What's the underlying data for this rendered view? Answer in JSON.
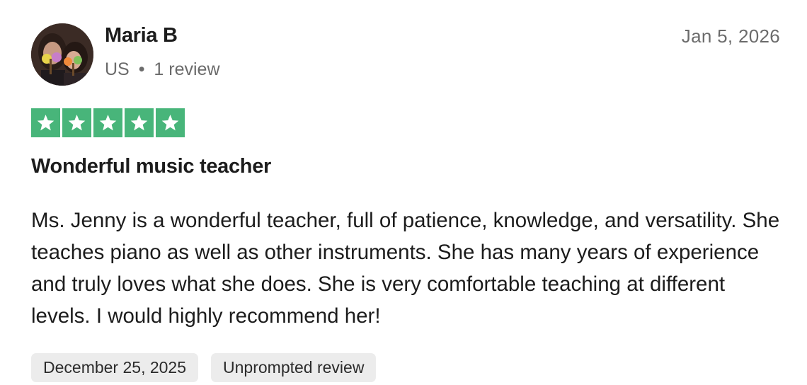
{
  "review": {
    "reviewer_name": "Maria B",
    "country": "US",
    "separator": "•",
    "review_count": "1 review",
    "date": "Jan 5, 2026",
    "rating": 5,
    "rating_max": 5,
    "title": "Wonderful music teacher",
    "body": "Ms. Jenny is a wonderful teacher, full of patience, knowledge, and versatility. She teaches piano as well as other instruments. She has many years of experience and truly loves what she does. She is very comfortable teaching at different levels. I would highly recommend her!",
    "tags": {
      "experience_date": "December 25, 2025",
      "review_type": "Unprompted review"
    }
  },
  "colors": {
    "star_green": "#48b57a",
    "tag_background": "#ececec",
    "muted_text": "#6b6b6b"
  },
  "icons": {
    "avatar": "reviewer-photo",
    "star": "star-icon"
  }
}
